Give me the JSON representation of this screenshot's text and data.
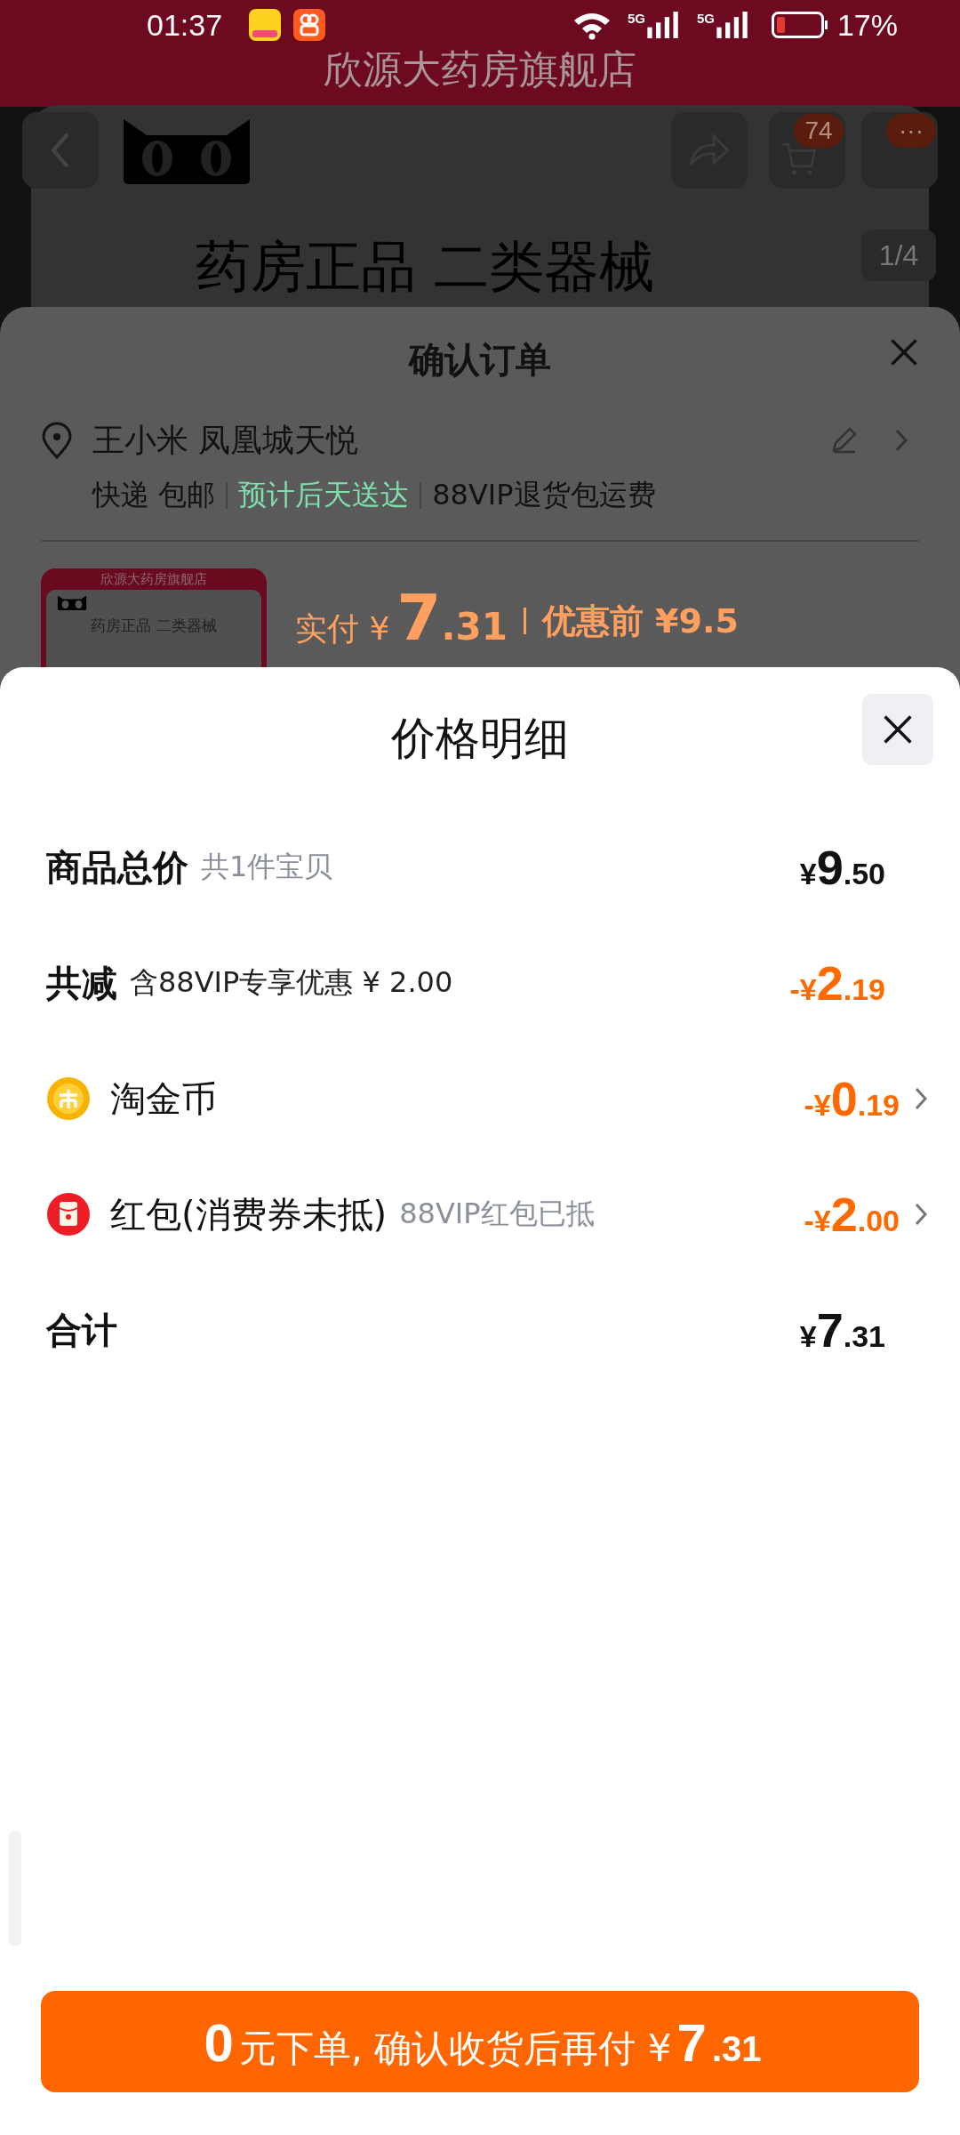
{
  "status_bar": {
    "time": "01:37",
    "battery": "17%",
    "network_labels": [
      "5G",
      "5G"
    ]
  },
  "store_header": {
    "title": "欣源大药房旗舰店"
  },
  "product_page": {
    "cart_count": "74",
    "more": "···",
    "image_counter": "1/4",
    "banner_text": "药房正品 二类器械"
  },
  "order_sheet": {
    "title": "确认订单",
    "address": "王小米 凤凰城天悦",
    "delivery": [
      {
        "text": "快递 包邮",
        "kind": "plain"
      },
      {
        "text": "预计后天送达",
        "kind": "highlight"
      },
      {
        "text": "88VIP退货包运费",
        "kind": "plain"
      }
    ],
    "thumbnail": {
      "store": "欣源大药房旗舰店",
      "product": "药房正品 二类器械"
    },
    "paid_label": "实付",
    "paid_currency": "¥",
    "paid_integer": "7",
    "paid_decimal": ".31",
    "original_label": "优惠前",
    "original_price": "¥9.5"
  },
  "price_detail": {
    "title": "价格明细",
    "rows": [
      {
        "kind": "plain",
        "label": "商品总价",
        "note": "共1件宝贝",
        "note_muted": true,
        "prefix": "¥",
        "integer": "9",
        "decimal": ".50",
        "discount": false,
        "link": false
      },
      {
        "kind": "plain",
        "label": "共减",
        "note": "含88VIP专享优惠 ¥ 2.00",
        "note_muted": false,
        "prefix": "-¥",
        "integer": "2",
        "decimal": ".19",
        "discount": true,
        "link": false
      },
      {
        "kind": "coin",
        "label": "淘金币",
        "prefix": "-¥",
        "integer": "0",
        "decimal": ".19",
        "discount": true,
        "link": true
      },
      {
        "kind": "red_packet",
        "label": "红包(消费券未抵)",
        "note": "88VIP红包已抵",
        "note_muted": true,
        "prefix": "-¥",
        "integer": "2",
        "decimal": ".00",
        "discount": true,
        "link": true
      },
      {
        "kind": "plain",
        "label": "合计",
        "prefix": "¥",
        "integer": "7",
        "decimal": ".31",
        "discount": false,
        "link": false
      }
    ],
    "confirm_button": {
      "lead_amount": "0",
      "text": "元下单, 确认收货后再付 ¥",
      "amount_integer": "7",
      "amount_decimal": ".31"
    }
  }
}
